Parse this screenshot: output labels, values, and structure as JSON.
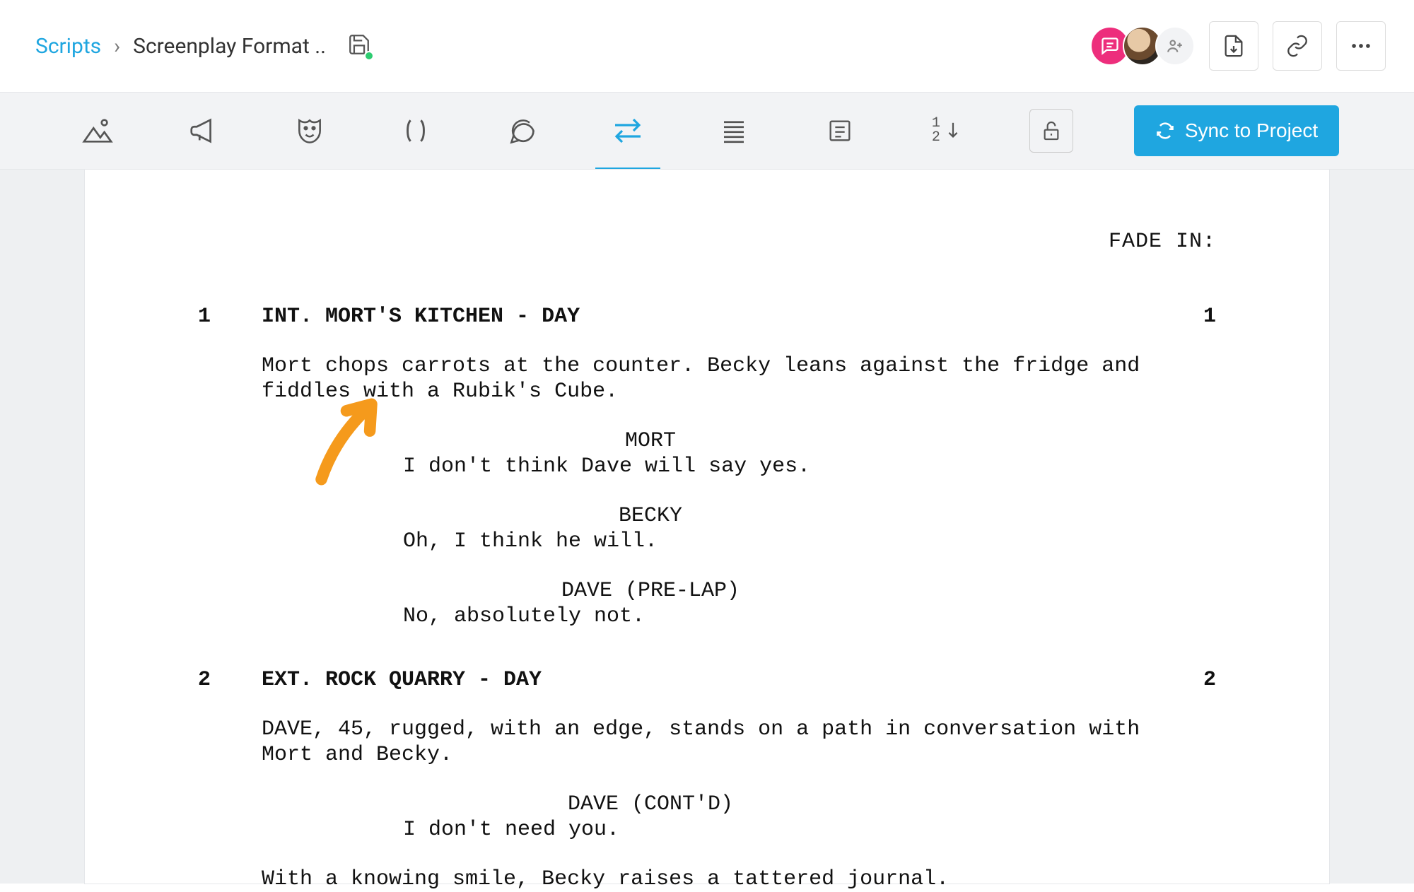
{
  "breadcrumb": {
    "root": "Scripts",
    "title": "Screenplay Format .."
  },
  "header": {
    "sync_label": "Sync to Project"
  },
  "script": {
    "transition": "FADE IN:",
    "scenes": [
      {
        "num": "1",
        "heading": "INT. MORT'S KITCHEN - DAY",
        "action1": "Mort chops carrots at the counter. Becky leans against the fridge and fiddles with a Rubik's Cube.",
        "d1_char": "MORT",
        "d1_line": "I don't think Dave will say yes.",
        "d2_char": "BECKY",
        "d2_line": "Oh, I think he will.",
        "d3_char": "DAVE (PRE-LAP)",
        "d3_line": "No, absolutely not."
      },
      {
        "num": "2",
        "heading": "EXT. ROCK QUARRY - DAY",
        "action1": "DAVE, 45, rugged, with an edge, stands on a path in conversation with Mort and Becky.",
        "d1_char": "DAVE (CONT'D)",
        "d1_line": "I don't need you.",
        "action2": "With a knowing smile, Becky raises a tattered journal."
      }
    ]
  }
}
